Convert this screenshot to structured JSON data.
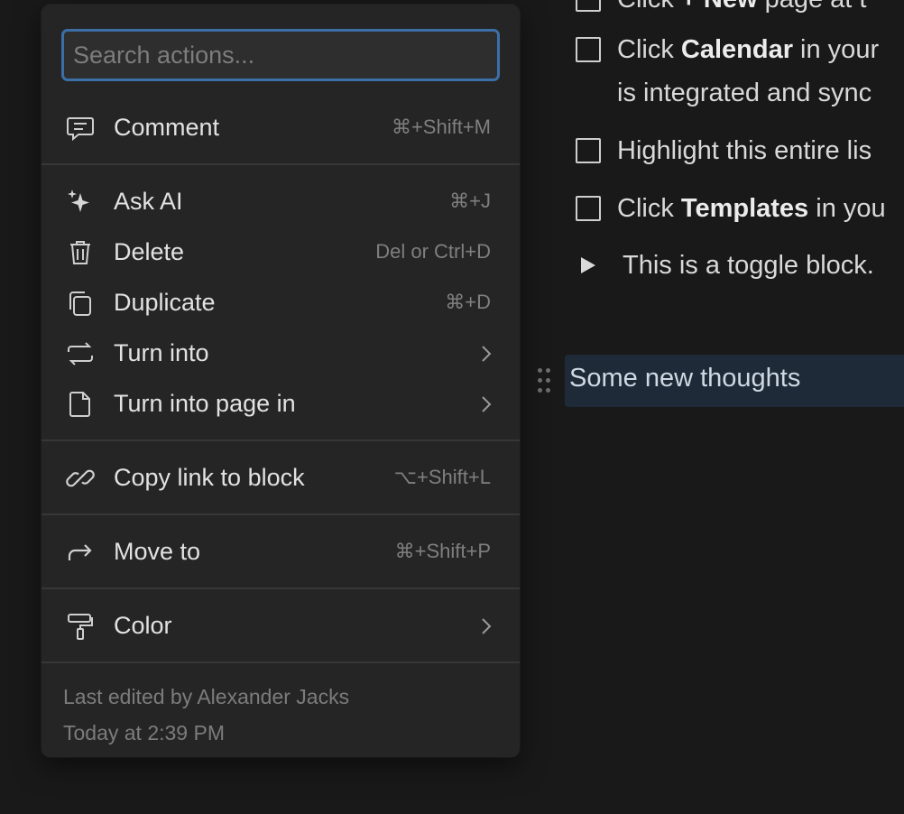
{
  "page": {
    "todos": [
      {
        "pre": "Click ",
        "bold": "+ New",
        "post": " page at t",
        "line2": ""
      },
      {
        "pre": "Click ",
        "bold": "Calendar",
        "post": " in your",
        "line2": "is integrated and sync"
      },
      {
        "pre": "Highlight this entire lis",
        "bold": "",
        "post": "",
        "line2": ""
      },
      {
        "pre": "Click ",
        "bold": "Templates",
        "post": " in you",
        "line2": ""
      }
    ],
    "toggle_text": "This is a toggle block.",
    "selected_block_text": "Some new thoughts"
  },
  "menu": {
    "search_placeholder": "Search actions...",
    "items": [
      {
        "label": "Comment",
        "shortcut": "⌘+Shift+M",
        "icon": "comment-icon"
      },
      {
        "label": "Ask AI",
        "shortcut": "⌘+J",
        "icon": "sparkle-icon"
      },
      {
        "label": "Delete",
        "shortcut": "Del or Ctrl+D",
        "icon": "trash-icon"
      },
      {
        "label": "Duplicate",
        "shortcut": "⌘+D",
        "icon": "duplicate-icon"
      },
      {
        "label": "Turn into",
        "shortcut": "",
        "icon": "turn-into-icon",
        "submenu": true
      },
      {
        "label": "Turn into page in",
        "shortcut": "",
        "icon": "page-icon",
        "submenu": true
      },
      {
        "label": "Copy link to block",
        "shortcut": "⌥+Shift+L",
        "icon": "link-icon"
      },
      {
        "label": "Move to",
        "shortcut": "⌘+Shift+P",
        "icon": "move-arrow-icon"
      },
      {
        "label": "Color",
        "shortcut": "",
        "icon": "paint-roller-icon",
        "submenu": true
      }
    ],
    "footer": {
      "line1": "Last edited by Alexander Jacks",
      "line2": "Today at 2:39 PM"
    }
  },
  "colors": {
    "background": "#191919",
    "menu_bg": "#252525",
    "search_focus": "#3c6fa8",
    "selected_block": "#1e2a38"
  }
}
